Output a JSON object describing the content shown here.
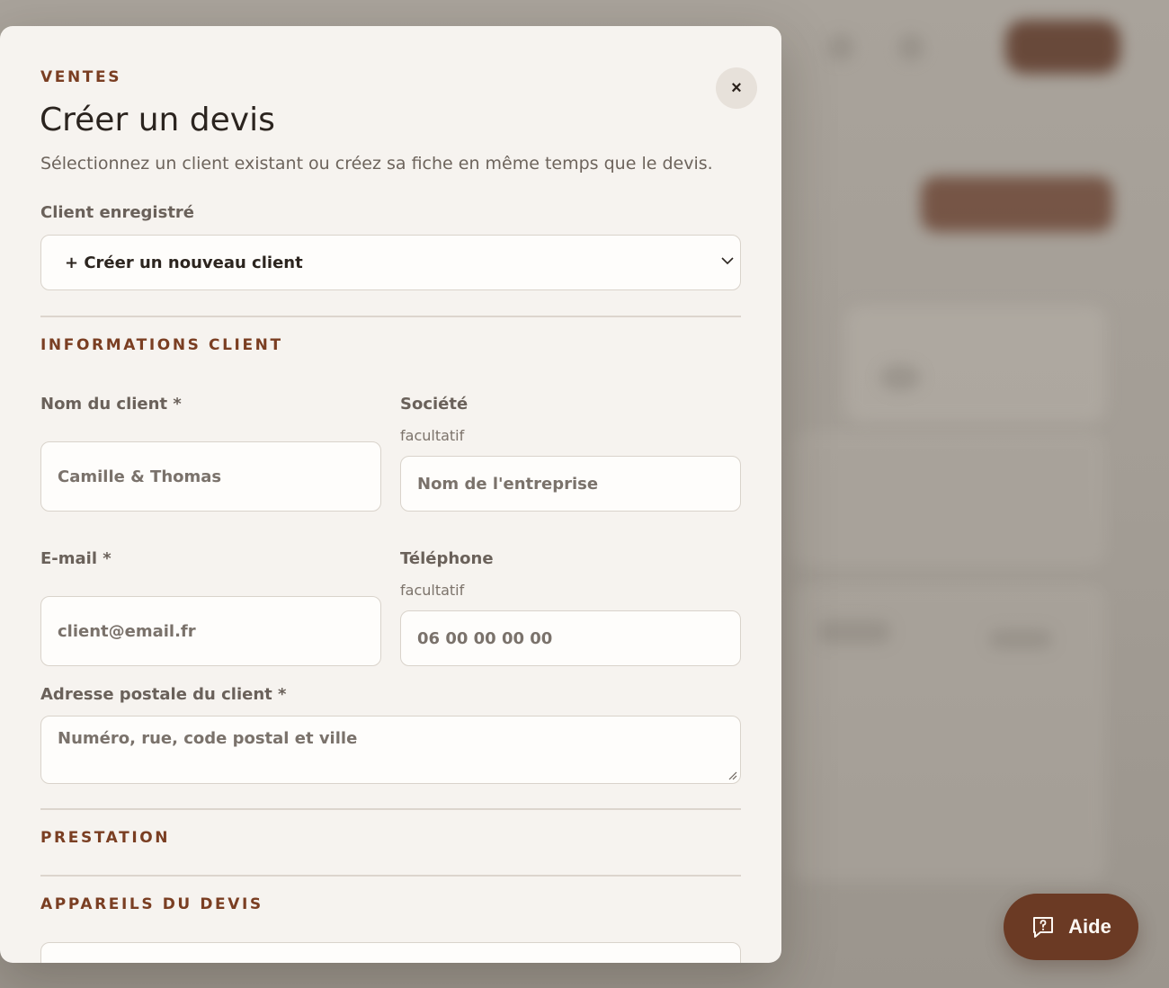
{
  "modal": {
    "eyebrow": "VENTES",
    "title": "Créer un devis",
    "subtitle": "Sélectionnez un client existant ou créez sa fiche en même temps que le devis.",
    "close_label": "×"
  },
  "client_select": {
    "label": "Client enregistré",
    "value": "+ Créer un nouveau client"
  },
  "client_info": {
    "heading": "INFORMATIONS CLIENT",
    "name": {
      "label": "Nom du client *",
      "value": "Camille & Thomas"
    },
    "company": {
      "label": "Société",
      "hint": "facultatif",
      "placeholder": "Nom de l'entreprise"
    },
    "email": {
      "label": "E-mail *",
      "placeholder": "client@email.fr"
    },
    "phone": {
      "label": "Téléphone",
      "hint": "facultatif",
      "placeholder": "06 00 00 00 00"
    },
    "address": {
      "label": "Adresse postale du client *",
      "placeholder": "Numéro, rue, code postal et ville"
    }
  },
  "sections": {
    "prestation": "PRESTATION",
    "appareils": "APPAREILS DU DEVIS"
  },
  "help": {
    "label": "Aide",
    "icon": "help-chat-icon"
  },
  "colors": {
    "accent": "#6b3a24",
    "eyebrow": "#7a3e22",
    "modal_bg": "#f6f3ef"
  }
}
